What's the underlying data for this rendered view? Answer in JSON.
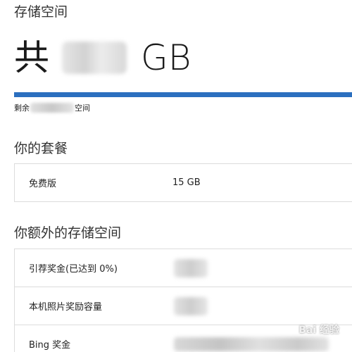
{
  "storage": {
    "title": "存储空间",
    "total_prefix": "共",
    "total_unit": "GB",
    "remaining_prefix": "剩余",
    "remaining_suffix": "空间",
    "used_fraction": 1.0,
    "bar_color": "#2b6fbf",
    "track_color": "#cfcfcf"
  },
  "plan": {
    "title": "你的套餐",
    "rows": [
      {
        "label": "免费版",
        "value": "15 GB"
      }
    ]
  },
  "extra": {
    "title": "你额外的存储空间",
    "rows": [
      {
        "label": "引荐奖金(已达到 0%)"
      },
      {
        "label": "本机照片奖励容量"
      },
      {
        "label": "Bing 奖金"
      }
    ]
  },
  "watermark": "Bai 经验"
}
